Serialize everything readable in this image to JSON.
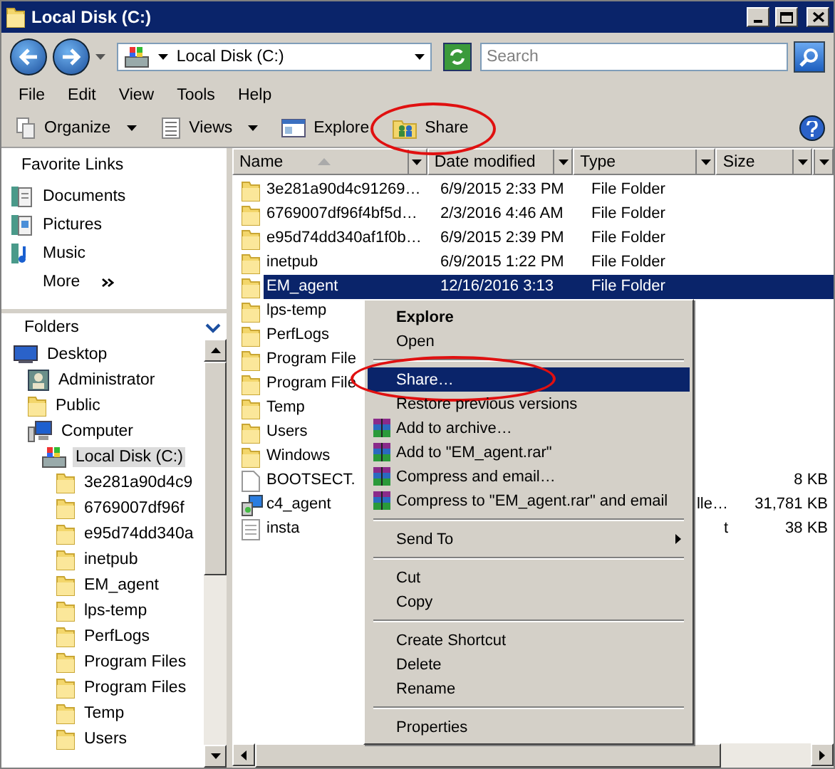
{
  "window": {
    "title": "Local Disk (C:)"
  },
  "address_bar": {
    "path": "Local Disk (C:)"
  },
  "search": {
    "placeholder": "Search"
  },
  "menu_bar": [
    "File",
    "Edit",
    "View",
    "Tools",
    "Help"
  ],
  "toolbar": [
    {
      "label": "Organize",
      "kind": "organize",
      "dropdown": true,
      "circled": false
    },
    {
      "label": "Views",
      "kind": "views",
      "dropdown": true,
      "circled": false
    },
    {
      "label": "Explore",
      "kind": "explore",
      "dropdown": false,
      "circled": false
    },
    {
      "label": "Share",
      "kind": "share",
      "dropdown": false,
      "circled": true
    }
  ],
  "favorite_links": {
    "title": "Favorite Links",
    "items": [
      {
        "label": "Documents",
        "kind": "documents"
      },
      {
        "label": "Pictures",
        "kind": "pictures"
      },
      {
        "label": "Music",
        "kind": "music"
      },
      {
        "label": "More",
        "kind": "more"
      }
    ]
  },
  "folders": {
    "title": "Folders",
    "tree": [
      {
        "label": "Desktop",
        "kind": "desktop",
        "selected": false,
        "children": [
          {
            "label": "Administrator",
            "kind": "user",
            "selected": false
          },
          {
            "label": "Public",
            "kind": "folder",
            "selected": false
          },
          {
            "label": "Computer",
            "kind": "computer",
            "selected": false,
            "children": [
              {
                "label": "Local Disk (C:)",
                "kind": "drive",
                "selected": true,
                "children": [
                  {
                    "label": "3e281a90d4c9",
                    "kind": "folder",
                    "selected": false
                  },
                  {
                    "label": "6769007df96f",
                    "kind": "folder",
                    "selected": false
                  },
                  {
                    "label": "e95d74dd340a",
                    "kind": "folder",
                    "selected": false
                  },
                  {
                    "label": "inetpub",
                    "kind": "folder",
                    "selected": false
                  },
                  {
                    "label": "EM_agent",
                    "kind": "folder",
                    "selected": false
                  },
                  {
                    "label": "lps-temp",
                    "kind": "folder",
                    "selected": false
                  },
                  {
                    "label": "PerfLogs",
                    "kind": "folder",
                    "selected": false
                  },
                  {
                    "label": "Program Files",
                    "kind": "folder",
                    "selected": false
                  },
                  {
                    "label": "Program Files",
                    "kind": "folder",
                    "selected": false
                  },
                  {
                    "label": "Temp",
                    "kind": "folder",
                    "selected": false
                  },
                  {
                    "label": "Users",
                    "kind": "folder",
                    "selected": false
                  }
                ]
              }
            ]
          }
        ]
      }
    ]
  },
  "file_list": {
    "columns": [
      {
        "label": "Name",
        "sorted": true
      },
      {
        "label": "Date modified",
        "sorted": false
      },
      {
        "label": "Type",
        "sorted": false
      },
      {
        "label": "Size",
        "sorted": false
      }
    ],
    "rows": [
      {
        "name": "3e281a90d4c91269…",
        "date": "6/9/2015 2:33 PM",
        "type": "File Folder",
        "kind": "folder",
        "selected": false
      },
      {
        "name": "6769007df96f4bf5d…",
        "date": "2/3/2016 4:46 AM",
        "type": "File Folder",
        "kind": "folder",
        "selected": false
      },
      {
        "name": "e95d74dd340af1f0b…",
        "date": "6/9/2015 2:39 PM",
        "type": "File Folder",
        "kind": "folder",
        "selected": false
      },
      {
        "name": "inetpub",
        "date": "6/9/2015 1:22 PM",
        "type": "File Folder",
        "kind": "folder",
        "selected": false
      },
      {
        "name": "EM_agent",
        "date": "12/16/2016 3:13",
        "type": "File Folder",
        "kind": "folder",
        "selected": true
      },
      {
        "name": "lps-temp",
        "kind": "folder",
        "selected": false
      },
      {
        "name": "PerfLogs",
        "kind": "folder",
        "selected": false
      },
      {
        "name": "Program File",
        "kind": "folder",
        "selected": false
      },
      {
        "name": "Program File",
        "kind": "folder",
        "selected": false
      },
      {
        "name": "Temp",
        "kind": "folder",
        "selected": false
      },
      {
        "name": "Users",
        "kind": "folder",
        "selected": false
      },
      {
        "name": "Windows",
        "kind": "folder",
        "selected": false
      },
      {
        "name": "BOOTSECT.",
        "size": "8 KB",
        "kind": "file",
        "selected": false
      },
      {
        "name": "c4_agent",
        "type": "lle…",
        "size": "31,781 KB",
        "kind": "installer",
        "selected": false
      },
      {
        "name": "insta",
        "type": "t",
        "size": "38 KB",
        "kind": "text",
        "selected": false
      }
    ]
  },
  "context_menu": {
    "items": [
      {
        "kind": "item",
        "label": "Explore",
        "default": true,
        "highlighted": false,
        "circled": false
      },
      {
        "kind": "item",
        "label": "Open",
        "default": false,
        "highlighted": false,
        "circled": false
      },
      {
        "kind": "separator"
      },
      {
        "kind": "item",
        "label": "Share…",
        "default": false,
        "highlighted": true,
        "circled": true
      },
      {
        "kind": "item",
        "label": "Restore previous versions",
        "default": false,
        "highlighted": false,
        "circled": false
      },
      {
        "kind": "archive",
        "label": "Add to archive…",
        "default": false,
        "highlighted": false,
        "circled": false
      },
      {
        "kind": "archive",
        "label": "Add to \"EM_agent.rar\"",
        "default": false,
        "highlighted": false,
        "circled": false
      },
      {
        "kind": "archive",
        "label": "Compress and email…",
        "default": false,
        "highlighted": false,
        "circled": false
      },
      {
        "kind": "archive",
        "label": "Compress to \"EM_agent.rar\" and email",
        "default": false,
        "highlighted": false,
        "circled": false
      },
      {
        "kind": "separator"
      },
      {
        "kind": "submenu",
        "label": "Send To",
        "default": false,
        "highlighted": false,
        "circled": false
      },
      {
        "kind": "separator"
      },
      {
        "kind": "item",
        "label": "Cut",
        "default": false,
        "highlighted": false,
        "circled": false
      },
      {
        "kind": "item",
        "label": "Copy",
        "default": false,
        "highlighted": false,
        "circled": false
      },
      {
        "kind": "separator"
      },
      {
        "kind": "item",
        "label": "Create Shortcut",
        "default": false,
        "highlighted": false,
        "circled": false
      },
      {
        "kind": "item",
        "label": "Delete",
        "default": false,
        "highlighted": false,
        "circled": false
      },
      {
        "kind": "item",
        "label": "Rename",
        "default": false,
        "highlighted": false,
        "circled": false
      },
      {
        "kind": "separator"
      },
      {
        "kind": "item",
        "label": "Properties",
        "default": false,
        "highlighted": false,
        "circled": false
      }
    ]
  }
}
